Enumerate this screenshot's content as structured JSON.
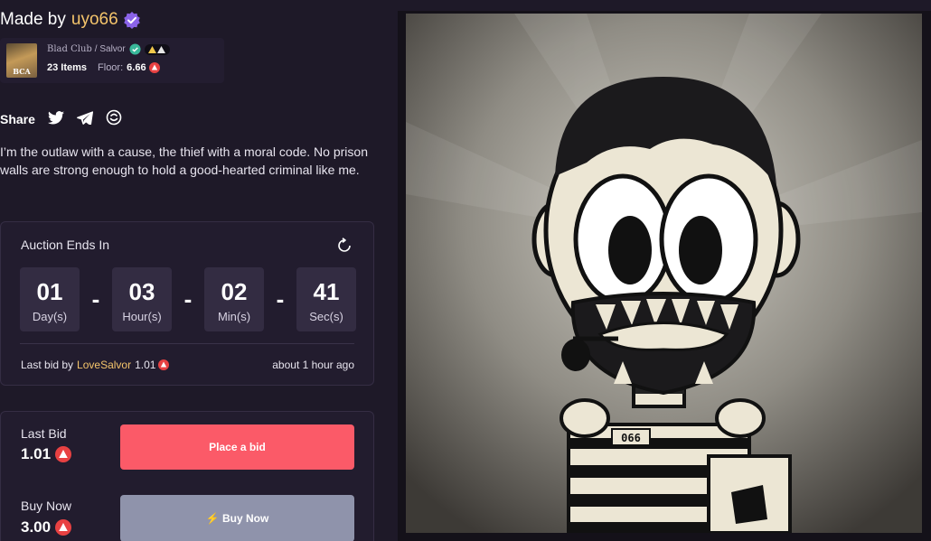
{
  "made_by": {
    "prefix": "Made by",
    "username": "uyo66"
  },
  "collection": {
    "thumb_text": "BCA",
    "name": "Blad Club",
    "separator": "/ Salvor",
    "items": "23 Items",
    "floor_label": "Floor:",
    "floor_value": "6.66"
  },
  "share": {
    "label": "Share",
    "icons": [
      "twitter-icon",
      "telegram-icon",
      "link-icon"
    ]
  },
  "description": "I’m the outlaw with a cause, the thief with a moral code. No prison walls are strong enough to hold a good-hearted criminal like me.",
  "auction": {
    "label": "Auction Ends In",
    "countdown": [
      {
        "value": "01",
        "unit": "Day(s)"
      },
      {
        "value": "03",
        "unit": "Hour(s)"
      },
      {
        "value": "02",
        "unit": "Min(s)"
      },
      {
        "value": "41",
        "unit": "Sec(s)"
      }
    ],
    "separator": "-",
    "last_bid_prefix": "Last bid by",
    "last_bidder": "LoveSalvor",
    "last_bid_amount": "1.01",
    "time_ago": "about 1 hour ago"
  },
  "bid_panel": {
    "last_bid_label": "Last Bid",
    "last_bid_value": "1.01",
    "place_bid_label": "Place a bid",
    "buy_now_label": "Buy Now",
    "buy_now_value": "3.00",
    "buy_now_button": "⚡ Buy Now"
  },
  "artwork": {
    "tag": "066"
  },
  "colors": {
    "background": "#1e1928",
    "accent_username": "#f4c46b",
    "place_bid": "#fb5a68",
    "buy_now": "#8f93ab",
    "avax_red": "#e84142"
  }
}
